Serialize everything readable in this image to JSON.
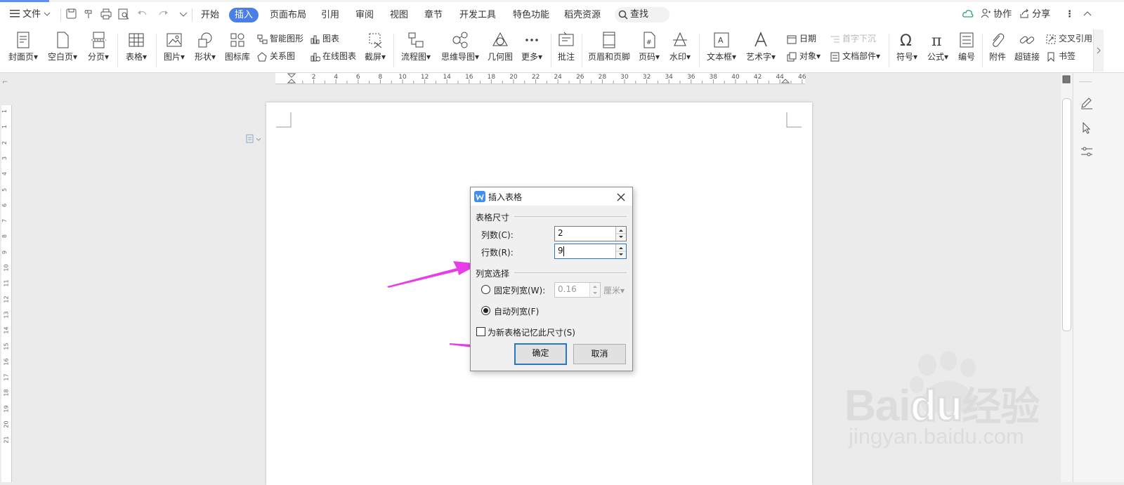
{
  "menubar": {
    "file_label": "文件",
    "tabs": [
      "开始",
      "插入",
      "页面布局",
      "引用",
      "审阅",
      "视图",
      "章节",
      "开发工具",
      "特色功能",
      "稻壳资源"
    ],
    "active_tab": "插入",
    "search_label": "查找",
    "collab_label": "协作",
    "share_label": "分享"
  },
  "ribbon": {
    "cover": "封面页",
    "blank": "空白页",
    "pagebreak": "分页",
    "table": "表格",
    "picture": "图片",
    "shape": "形状",
    "iconlib": "图标库",
    "smartart": "智能图形",
    "chart": "图表",
    "relation": "关系图",
    "online_chart": "在线图表",
    "screenshot": "截屏",
    "flowchart": "流程图",
    "mindmap": "思维导图",
    "geometry": "几何图",
    "more": "更多",
    "comment": "批注",
    "header_footer": "页眉和页脚",
    "page_number": "页码",
    "watermark": "水印",
    "textbox": "文本框",
    "wordart": "艺术字",
    "date": "日期",
    "dropcap": "首字下沉",
    "object": "对象",
    "doc_parts": "文档部件",
    "symbol": "符号",
    "formula": "公式",
    "numbering": "编号",
    "attachment": "附件",
    "hyperlink": "超链接",
    "cross_ref": "交叉引用",
    "bookmark": "书签"
  },
  "hruler_numbers": [
    "2",
    "4",
    "6",
    "8",
    "10",
    "12",
    "14",
    "16",
    "18",
    "20",
    "22",
    "24",
    "26",
    "28",
    "30",
    "32",
    "34",
    "36",
    "38",
    "40",
    "42",
    "44",
    "46"
  ],
  "vruler_numbers": [
    "1",
    "1",
    "2",
    "3",
    "4",
    "5",
    "6",
    "7",
    "8",
    "9",
    "10",
    "11",
    "12",
    "13",
    "14",
    "15",
    "16",
    "17",
    "18",
    "19",
    "20",
    "21"
  ],
  "dialog": {
    "title": "插入表格",
    "section_size": "表格尺寸",
    "columns_label": "列数(C):",
    "columns_value": "2",
    "rows_label": "行数(R):",
    "rows_value": "9",
    "section_width": "列宽选择",
    "fixed_width_label": "固定列宽(W):",
    "fixed_width_value": "0.16",
    "fixed_width_unit": "厘米",
    "auto_width_label": "自动列宽(F)",
    "auto_width_selected": true,
    "remember_label": "为新表格记忆此尺寸(S)",
    "ok_label": "确定",
    "cancel_label": "取消"
  },
  "watermark": {
    "brand": "Bai",
    "brand2": "du",
    "cn": "经验",
    "url": "jingyan.baidu.com"
  },
  "colors": {
    "accent": "#4a7fe8",
    "arrow": "#e83ee8",
    "dialog_primary_border": "#2a76c6"
  }
}
